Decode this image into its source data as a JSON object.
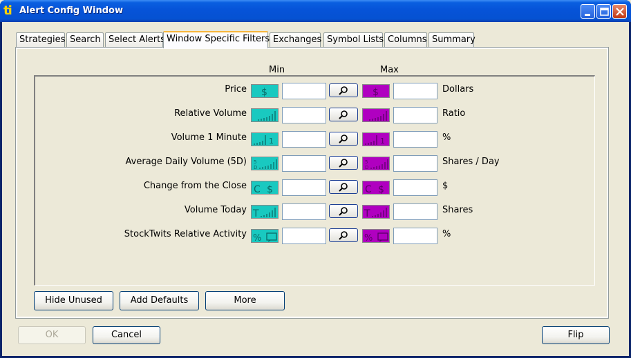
{
  "window": {
    "title": "Alert Config Window",
    "app_icon": "ti"
  },
  "tabs": [
    {
      "label": "Strategies"
    },
    {
      "label": "Search"
    },
    {
      "label": "Select Alerts"
    },
    {
      "label": "Window Specific Filters",
      "active": true
    },
    {
      "label": "Exchanges"
    },
    {
      "label": "Symbol Lists"
    },
    {
      "label": "Columns"
    },
    {
      "label": "Summary"
    }
  ],
  "filters": {
    "min_header": "Min",
    "max_header": "Max",
    "rows": [
      {
        "label": "Price",
        "icon": "price-dollar-icon",
        "min": "",
        "max": "",
        "unit": "Dollars"
      },
      {
        "label": "Relative Volume",
        "icon": "relative-volume-icon",
        "min": "",
        "max": "",
        "unit": "Ratio"
      },
      {
        "label": "Volume 1 Minute",
        "icon": "volume-1-minute-icon",
        "min": "",
        "max": "",
        "unit": "%"
      },
      {
        "label": "Average Daily Volume (5D)",
        "icon": "average-daily-volume-icon",
        "min": "",
        "max": "",
        "unit": "Shares / Day"
      },
      {
        "label": "Change from the Close",
        "icon": "change-from-close-icon",
        "min": "",
        "max": "",
        "unit": "$"
      },
      {
        "label": "Volume Today",
        "icon": "volume-today-icon",
        "min": "",
        "max": "",
        "unit": "Shares"
      },
      {
        "label": "StockTwits Relative Activity",
        "icon": "stocktwits-activity-icon",
        "min": "",
        "max": "",
        "unit": "%"
      }
    ]
  },
  "panel_buttons": {
    "hide_unused": "Hide Unused",
    "add_defaults": "Add Defaults",
    "more": "More"
  },
  "footer": {
    "ok": "OK",
    "cancel": "Cancel",
    "flip": "Flip"
  },
  "colors": {
    "min_icon": "#19c9c0",
    "max_icon": "#b000c0",
    "titlebar": "#0653d8"
  }
}
